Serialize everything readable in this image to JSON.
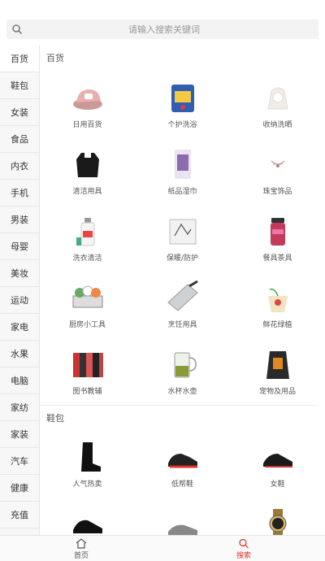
{
  "search": {
    "placeholder": "请输入搜索关键词"
  },
  "sidebar": {
    "items": [
      {
        "label": "百货"
      },
      {
        "label": "鞋包"
      },
      {
        "label": "女装"
      },
      {
        "label": "食品"
      },
      {
        "label": "内衣"
      },
      {
        "label": "手机"
      },
      {
        "label": "男装"
      },
      {
        "label": "母婴"
      },
      {
        "label": "美妆"
      },
      {
        "label": "运动"
      },
      {
        "label": "家电"
      },
      {
        "label": "水果"
      },
      {
        "label": "电脑"
      },
      {
        "label": "家纺"
      },
      {
        "label": "家装"
      },
      {
        "label": "汽车"
      },
      {
        "label": "健康"
      },
      {
        "label": "充值"
      }
    ],
    "active_index": 0
  },
  "sections": [
    {
      "title": "百货",
      "items": [
        {
          "label": "日用百货",
          "icon": "slipper-icon"
        },
        {
          "label": "个护洗浴",
          "icon": "tissue-pack-icon"
        },
        {
          "label": "收纳洗晒",
          "icon": "hanger-clip-icon"
        },
        {
          "label": "清洁用具",
          "icon": "trash-bag-icon"
        },
        {
          "label": "纸品湿巾",
          "icon": "paper-roll-icon"
        },
        {
          "label": "珠宝饰品",
          "icon": "jewelry-icon"
        },
        {
          "label": "洗衣清洁",
          "icon": "detergent-icon"
        },
        {
          "label": "保暖/防护",
          "icon": "mask-pack-icon"
        },
        {
          "label": "餐具茶具",
          "icon": "thermos-icon"
        },
        {
          "label": "厨房小工具",
          "icon": "dish-rack-icon"
        },
        {
          "label": "烹饪用具",
          "icon": "cleaver-icon"
        },
        {
          "label": "鲜花绿植",
          "icon": "flower-pot-icon"
        },
        {
          "label": "图书教辅",
          "icon": "books-icon"
        },
        {
          "label": "水杯水壶",
          "icon": "glass-cup-icon"
        },
        {
          "label": "宠物及用品",
          "icon": "pet-food-icon"
        }
      ]
    },
    {
      "title": "鞋包",
      "items": [
        {
          "label": "人气热卖",
          "icon": "boot-icon"
        },
        {
          "label": "低帮鞋",
          "icon": "sneaker-icon"
        },
        {
          "label": "女鞋",
          "icon": "women-sneaker-icon"
        },
        {
          "label": "",
          "icon": "sneaker-icon"
        },
        {
          "label": "",
          "icon": "shoe-icon"
        },
        {
          "label": "",
          "icon": "watch-icon"
        }
      ]
    }
  ],
  "tabbar": {
    "items": [
      {
        "label": "首页",
        "icon": "home-icon"
      },
      {
        "label": "搜索",
        "icon": "search-icon"
      }
    ],
    "active_index": 1
  },
  "colors": {
    "accent": "#e02e24",
    "sidebar_bg": "#f7f7f7",
    "search_bg": "#f3f3f3"
  }
}
